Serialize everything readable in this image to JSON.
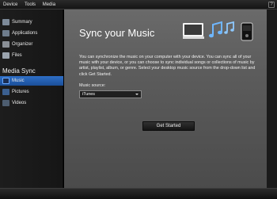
{
  "menu": {
    "items": [
      "Device",
      "Tools",
      "Media"
    ],
    "help_label": "?"
  },
  "sidebar": {
    "items": [
      {
        "label": "Summary",
        "icon": "summary-icon"
      },
      {
        "label": "Applications",
        "icon": "applications-icon"
      },
      {
        "label": "Organizer",
        "icon": "organizer-icon"
      },
      {
        "label": "Files",
        "icon": "files-icon"
      }
    ],
    "media_header": "Media Sync",
    "media_items": [
      {
        "label": "Music",
        "icon": "music-icon",
        "selected": true
      },
      {
        "label": "Pictures",
        "icon": "pictures-icon"
      },
      {
        "label": "Videos",
        "icon": "videos-icon"
      }
    ]
  },
  "main": {
    "title": "Sync your Music",
    "description": "You can synchronize the music on your computer with your device.  You can sync all of your music with your device, or you can choose to sync individual songs or collections of music by artist, playlist, album, or genre.  Select your desktop music source from the drop-down list and click Get Started.",
    "source_label": "Music source:",
    "source_value": "iTunes",
    "button_label": "Get Started"
  },
  "colors": {
    "selected": "#2e6fc7",
    "accent_music": "#4aa8ff"
  }
}
